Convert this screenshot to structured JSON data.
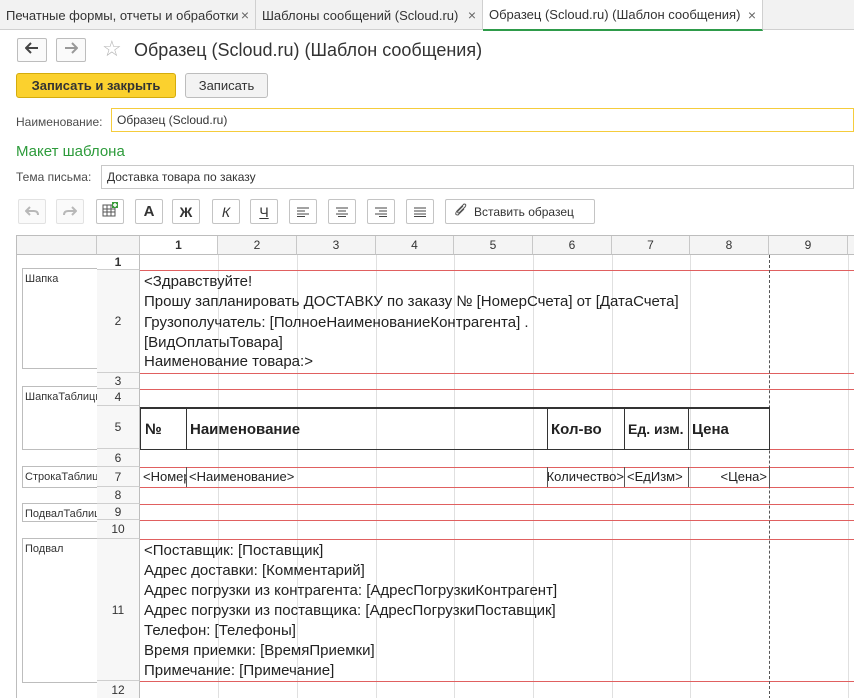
{
  "tabs": [
    {
      "label": "Печатные формы, отчеты и обработки"
    },
    {
      "label": "Шаблоны сообщений (Scloud.ru)"
    },
    {
      "label": "Образец (Scloud.ru) (Шаблон сообщения)"
    }
  ],
  "icons": {
    "close": "×",
    "back": "🡐",
    "forward": "🡒",
    "star": "☆"
  },
  "header": {
    "title": "Образец (Scloud.ru) (Шаблон сообщения)"
  },
  "toolbar": {
    "save_close": "Записать и закрыть",
    "save": "Записать"
  },
  "form": {
    "name_label": "Наименование:",
    "name_value": "Образец (Scloud.ru)",
    "section_title": "Макет шаблона",
    "subject_label": "Тема письма:",
    "subject_value": "Доставка товара по заказу"
  },
  "editor_toolbar": {
    "bold": "Ж",
    "italic": "К",
    "underline": "Ч",
    "font": "A",
    "insert_sample": "Вставить образец"
  },
  "sheet": {
    "columns": [
      "1",
      "2",
      "3",
      "4",
      "5",
      "6",
      "7",
      "8",
      "9"
    ],
    "rows": [
      "1",
      "2",
      "3",
      "4",
      "5",
      "6",
      "7",
      "8",
      "9",
      "10",
      "11",
      "12"
    ],
    "groups": [
      "Шапка",
      "ШапкаТаблицы",
      "СтрокаТаблицы",
      "ПодвалТаблицы",
      "Подвал"
    ],
    "header_text": [
      "<Здравствуйте!",
      "Прошу запланировать ДОСТАВКУ по заказу № [НомерСчета] от [ДатаСчета]",
      "Грузополучатель: [ПолноеНаименованиеКонтрагента] .",
      "[ВидОплатыТовара]",
      "Наименование товара:>"
    ],
    "table_head": [
      "№",
      "Наименование",
      "Кол-во",
      "Ед. изм.",
      "Цена"
    ],
    "table_row": [
      "<НомерСтроки>",
      "<Наименование>",
      "<Количество>",
      "<ЕдИзм>",
      "<Цена>"
    ],
    "footer_text": [
      "<Поставщик: [Поставщик]",
      "Адрес доставки: [Комментарий]",
      "Адрес погрузки из контрагента: [АдресПогрузкиКонтрагент]",
      "Адрес погрузки из поставщика: [АдресПогрузкиПоставщик]",
      "Телефон: [Телефоны]",
      "Время приемки: [ВремяПриемки]",
      "Примечание: [Примечание]"
    ]
  },
  "colors": {
    "accent": "#fbd12e",
    "green": "#2d9b3b",
    "red_line": "#e06060"
  }
}
